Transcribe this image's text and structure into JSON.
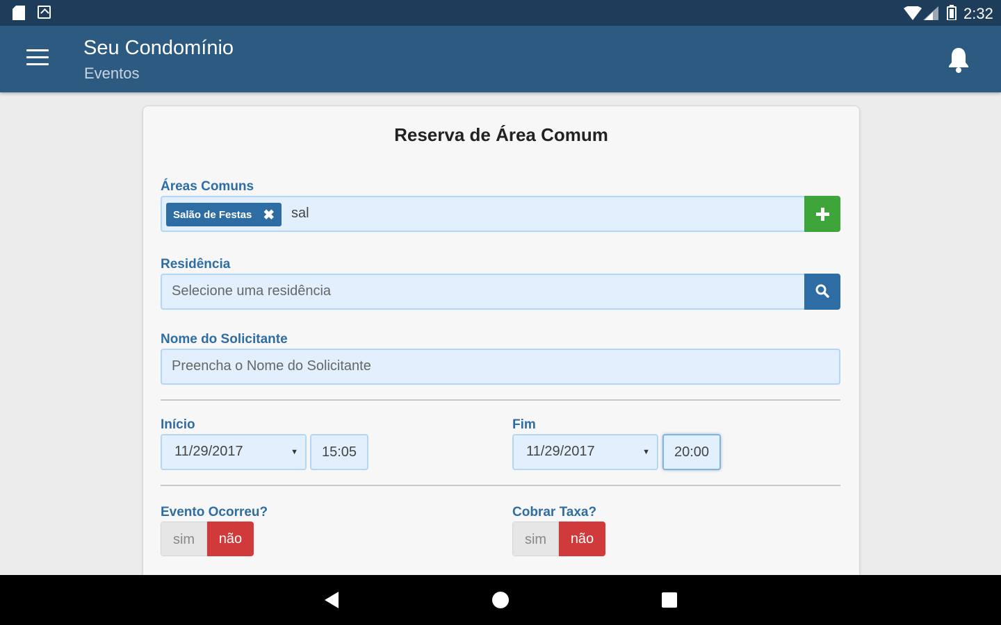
{
  "status_bar": {
    "time": "2:32",
    "icons": [
      "sd-card-icon",
      "app-notification-icon",
      "wifi-icon",
      "signal-icon",
      "battery-icon"
    ]
  },
  "app_bar": {
    "title": "Seu Condomínio",
    "subtitle": "Eventos",
    "icons": [
      "menu-icon",
      "bell-icon"
    ],
    "color": "#2c5a80"
  },
  "form": {
    "title": "Reserva de Área Comum",
    "areas_comuns": {
      "label": "Áreas Comuns",
      "tags": [
        "Salão de Festas"
      ],
      "typed_text": "sal",
      "add_button_icon": "plus-icon"
    },
    "residencia": {
      "label": "Residência",
      "placeholder": "Selecione uma residência",
      "search_button_icon": "search-icon"
    },
    "nome_solicitante": {
      "label": "Nome do Solicitante",
      "placeholder": "Preencha o Nome do Solicitante"
    },
    "inicio": {
      "label": "Início",
      "date": "11/29/2017",
      "time": "15:05"
    },
    "fim": {
      "label": "Fim",
      "date": "11/29/2017",
      "time": "20:00"
    },
    "evento_ocorreu": {
      "label": "Evento Ocorreu?",
      "options": [
        "sim",
        "não"
      ],
      "selected": "não"
    },
    "cobrar_taxa": {
      "label": "Cobrar Taxa?",
      "options": [
        "sim",
        "não"
      ],
      "selected": "não"
    }
  },
  "colors": {
    "accent": "#2e6da4",
    "add_green": "#3da53a",
    "toggle_red": "#d13a3a",
    "input_bg": "#e2f0fd"
  },
  "nav_bar": {
    "icons": [
      "back-icon",
      "home-icon",
      "recents-icon"
    ]
  }
}
